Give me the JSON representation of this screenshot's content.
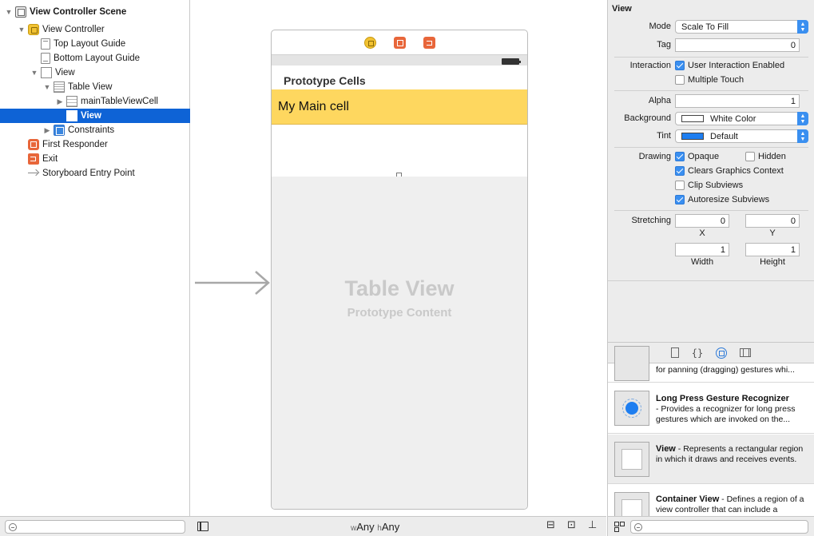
{
  "outline": {
    "items": [
      {
        "label": "View Controller Scene",
        "icon": "scene-icon",
        "expanded": true,
        "bold": true
      },
      {
        "label": "View Controller",
        "icon": "view-controller-icon",
        "expanded": true
      },
      {
        "label": "Top Layout Guide",
        "icon": "layout-guide-icon"
      },
      {
        "label": "Bottom Layout Guide",
        "icon": "layout-guide-icon"
      },
      {
        "label": "View",
        "icon": "view-icon",
        "expanded": true
      },
      {
        "label": "Table View",
        "icon": "table-view-icon",
        "expanded": true
      },
      {
        "label": "mainTableViewCell",
        "icon": "table-cell-icon",
        "expanded": false
      },
      {
        "label": "View",
        "icon": "view-icon",
        "selected": true
      },
      {
        "label": "Constraints",
        "icon": "constraints-icon",
        "expanded": false
      },
      {
        "label": "First Responder",
        "icon": "first-responder-icon"
      },
      {
        "label": "Exit",
        "icon": "exit-icon"
      },
      {
        "label": "Storyboard Entry Point",
        "icon": "entry-point-icon"
      }
    ],
    "filter_placeholder": ""
  },
  "canvas": {
    "prototype_cells_label": "Prototype Cells",
    "cell_label": "My Main cell",
    "table_view_title": "Table View",
    "table_view_subtitle": "Prototype Content",
    "size_class": {
      "w_prefix": "w",
      "w_value": "Any",
      "h_prefix": "h",
      "h_value": "Any"
    },
    "cell_color": "#fed75f"
  },
  "inspector": {
    "section_title": "View",
    "mode_label": "Mode",
    "mode_value": "Scale To Fill",
    "tag_label": "Tag",
    "tag_value": "0",
    "interaction_label": "Interaction",
    "user_interaction_label": "User Interaction Enabled",
    "user_interaction_checked": true,
    "multiple_touch_label": "Multiple Touch",
    "multiple_touch_checked": false,
    "alpha_label": "Alpha",
    "alpha_value": "1",
    "background_label": "Background",
    "background_value": "White Color",
    "background_color": "#ffffff",
    "tint_label": "Tint",
    "tint_value": "Default",
    "tint_color": "#1e7ef0",
    "drawing_label": "Drawing",
    "opaque_label": "Opaque",
    "opaque_checked": true,
    "hidden_label": "Hidden",
    "hidden_checked": false,
    "clears_label": "Clears Graphics Context",
    "clears_checked": true,
    "clip_label": "Clip Subviews",
    "clip_checked": false,
    "autoresize_label": "Autoresize Subviews",
    "autoresize_checked": true,
    "stretching_label": "Stretching",
    "stretch_x": "0",
    "stretch_y": "0",
    "stretch_width": "1",
    "stretch_height": "1",
    "x_label": "X",
    "y_label": "Y",
    "width_label": "Width",
    "height_label": "Height"
  },
  "library": {
    "items": [
      {
        "title": "",
        "desc": "for panning (dragging) gestures whi..."
      },
      {
        "title": "Long Press Gesture Recognizer",
        "desc": "- Provides a recognizer for long press gestures which are invoked on the..."
      },
      {
        "title": "View",
        "desc": " - Represents a rectangular region in which it draws and receives events."
      },
      {
        "title": "Container View",
        "desc": " - Defines a region of a view controller that can include a"
      }
    ],
    "filter_placeholder": ""
  }
}
